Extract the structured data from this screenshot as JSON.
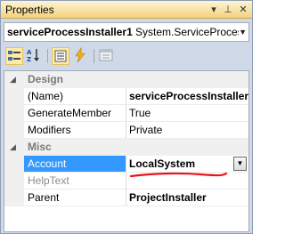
{
  "window": {
    "title": "Properties"
  },
  "titlebar_buttons": {
    "dropdown": "▾",
    "pin": "⊥",
    "close": "✕"
  },
  "selector": {
    "object_name": "serviceProcessInstaller1",
    "object_type": "System.ServiceProcess"
  },
  "toolbar": {
    "icons": [
      "categorized-icon",
      "alphabetical-icon",
      "properties-icon",
      "events-icon",
      "property-pages-icon"
    ]
  },
  "grid": {
    "categories": [
      {
        "name": "Design",
        "properties": [
          {
            "name": "(Name)",
            "value": "serviceProcessInstaller1",
            "bold": true
          },
          {
            "name": "GenerateMember",
            "value": "True",
            "bold": false
          },
          {
            "name": "Modifiers",
            "value": "Private",
            "bold": false
          }
        ]
      },
      {
        "name": "Misc",
        "properties": [
          {
            "name": "Account",
            "value": "LocalSystem",
            "bold": true,
            "selected": true
          },
          {
            "name": "HelpText",
            "value": "",
            "bold": false,
            "disabled": true
          },
          {
            "name": "Parent",
            "value": "ProjectInstaller",
            "bold": true
          }
        ]
      }
    ]
  },
  "colors": {
    "selection": "#3399ff",
    "annotation": "#e8141c",
    "titlebar": "#f3d27d"
  }
}
